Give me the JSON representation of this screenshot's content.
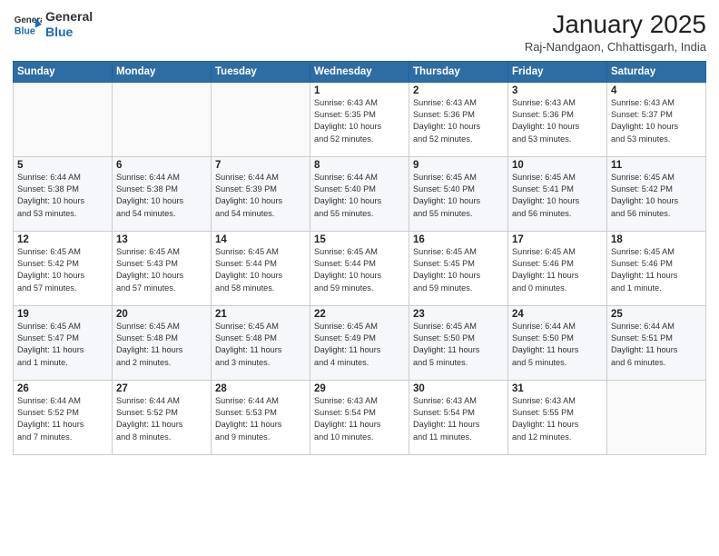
{
  "header": {
    "logo_line1": "General",
    "logo_line2": "Blue",
    "title": "January 2025",
    "subtitle": "Raj-Nandgaon, Chhattisgarh, India"
  },
  "weekdays": [
    "Sunday",
    "Monday",
    "Tuesday",
    "Wednesday",
    "Thursday",
    "Friday",
    "Saturday"
  ],
  "weeks": [
    [
      {
        "day": "",
        "info": ""
      },
      {
        "day": "",
        "info": ""
      },
      {
        "day": "",
        "info": ""
      },
      {
        "day": "1",
        "info": "Sunrise: 6:43 AM\nSunset: 5:35 PM\nDaylight: 10 hours\nand 52 minutes."
      },
      {
        "day": "2",
        "info": "Sunrise: 6:43 AM\nSunset: 5:36 PM\nDaylight: 10 hours\nand 52 minutes."
      },
      {
        "day": "3",
        "info": "Sunrise: 6:43 AM\nSunset: 5:36 PM\nDaylight: 10 hours\nand 53 minutes."
      },
      {
        "day": "4",
        "info": "Sunrise: 6:43 AM\nSunset: 5:37 PM\nDaylight: 10 hours\nand 53 minutes."
      }
    ],
    [
      {
        "day": "5",
        "info": "Sunrise: 6:44 AM\nSunset: 5:38 PM\nDaylight: 10 hours\nand 53 minutes."
      },
      {
        "day": "6",
        "info": "Sunrise: 6:44 AM\nSunset: 5:38 PM\nDaylight: 10 hours\nand 54 minutes."
      },
      {
        "day": "7",
        "info": "Sunrise: 6:44 AM\nSunset: 5:39 PM\nDaylight: 10 hours\nand 54 minutes."
      },
      {
        "day": "8",
        "info": "Sunrise: 6:44 AM\nSunset: 5:40 PM\nDaylight: 10 hours\nand 55 minutes."
      },
      {
        "day": "9",
        "info": "Sunrise: 6:45 AM\nSunset: 5:40 PM\nDaylight: 10 hours\nand 55 minutes."
      },
      {
        "day": "10",
        "info": "Sunrise: 6:45 AM\nSunset: 5:41 PM\nDaylight: 10 hours\nand 56 minutes."
      },
      {
        "day": "11",
        "info": "Sunrise: 6:45 AM\nSunset: 5:42 PM\nDaylight: 10 hours\nand 56 minutes."
      }
    ],
    [
      {
        "day": "12",
        "info": "Sunrise: 6:45 AM\nSunset: 5:42 PM\nDaylight: 10 hours\nand 57 minutes."
      },
      {
        "day": "13",
        "info": "Sunrise: 6:45 AM\nSunset: 5:43 PM\nDaylight: 10 hours\nand 57 minutes."
      },
      {
        "day": "14",
        "info": "Sunrise: 6:45 AM\nSunset: 5:44 PM\nDaylight: 10 hours\nand 58 minutes."
      },
      {
        "day": "15",
        "info": "Sunrise: 6:45 AM\nSunset: 5:44 PM\nDaylight: 10 hours\nand 59 minutes."
      },
      {
        "day": "16",
        "info": "Sunrise: 6:45 AM\nSunset: 5:45 PM\nDaylight: 10 hours\nand 59 minutes."
      },
      {
        "day": "17",
        "info": "Sunrise: 6:45 AM\nSunset: 5:46 PM\nDaylight: 11 hours\nand 0 minutes."
      },
      {
        "day": "18",
        "info": "Sunrise: 6:45 AM\nSunset: 5:46 PM\nDaylight: 11 hours\nand 1 minute."
      }
    ],
    [
      {
        "day": "19",
        "info": "Sunrise: 6:45 AM\nSunset: 5:47 PM\nDaylight: 11 hours\nand 1 minute."
      },
      {
        "day": "20",
        "info": "Sunrise: 6:45 AM\nSunset: 5:48 PM\nDaylight: 11 hours\nand 2 minutes."
      },
      {
        "day": "21",
        "info": "Sunrise: 6:45 AM\nSunset: 5:48 PM\nDaylight: 11 hours\nand 3 minutes."
      },
      {
        "day": "22",
        "info": "Sunrise: 6:45 AM\nSunset: 5:49 PM\nDaylight: 11 hours\nand 4 minutes."
      },
      {
        "day": "23",
        "info": "Sunrise: 6:45 AM\nSunset: 5:50 PM\nDaylight: 11 hours\nand 5 minutes."
      },
      {
        "day": "24",
        "info": "Sunrise: 6:44 AM\nSunset: 5:50 PM\nDaylight: 11 hours\nand 5 minutes."
      },
      {
        "day": "25",
        "info": "Sunrise: 6:44 AM\nSunset: 5:51 PM\nDaylight: 11 hours\nand 6 minutes."
      }
    ],
    [
      {
        "day": "26",
        "info": "Sunrise: 6:44 AM\nSunset: 5:52 PM\nDaylight: 11 hours\nand 7 minutes."
      },
      {
        "day": "27",
        "info": "Sunrise: 6:44 AM\nSunset: 5:52 PM\nDaylight: 11 hours\nand 8 minutes."
      },
      {
        "day": "28",
        "info": "Sunrise: 6:44 AM\nSunset: 5:53 PM\nDaylight: 11 hours\nand 9 minutes."
      },
      {
        "day": "29",
        "info": "Sunrise: 6:43 AM\nSunset: 5:54 PM\nDaylight: 11 hours\nand 10 minutes."
      },
      {
        "day": "30",
        "info": "Sunrise: 6:43 AM\nSunset: 5:54 PM\nDaylight: 11 hours\nand 11 minutes."
      },
      {
        "day": "31",
        "info": "Sunrise: 6:43 AM\nSunset: 5:55 PM\nDaylight: 11 hours\nand 12 minutes."
      },
      {
        "day": "",
        "info": ""
      }
    ]
  ]
}
